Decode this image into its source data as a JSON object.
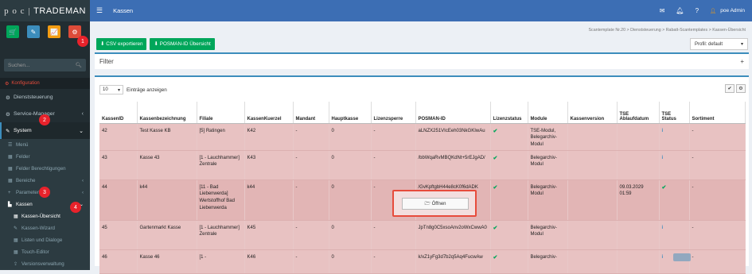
{
  "app": {
    "logo_left": "p o c",
    "logo_right": "TRADEMAN",
    "page_title": "Kassen"
  },
  "topbar": {
    "user": "poe Admin"
  },
  "colors": {
    "quick": [
      "#00a65a",
      "#3c8dbc",
      "#f39c12",
      "#dd4b39"
    ]
  },
  "quick_icons": [
    "cart-icon",
    "pencil-icon",
    "chart-icon",
    "gears-icon"
  ],
  "sidebar": {
    "search_placeholder": "Suchen...",
    "section": "Konfiguration",
    "items": [
      {
        "label": "Dienststeuerung",
        "icon": "⚙"
      },
      {
        "label": "Service-Manager",
        "icon": "⚙",
        "caret": "‹"
      },
      {
        "label": "System",
        "icon": "✎",
        "caret": "⌄"
      }
    ],
    "system_sub": [
      {
        "label": "Menü",
        "icon": "☰"
      },
      {
        "label": "Felder",
        "icon": "▦"
      },
      {
        "label": "Felder Berechtigungen",
        "icon": "▦"
      },
      {
        "label": "Bereiche",
        "icon": "▦",
        "caret": "‹"
      },
      {
        "label": "Parameter",
        "icon": "+",
        "caret": "‹"
      },
      {
        "label": "Kassen",
        "icon": "▙",
        "caret": "⌄"
      }
    ],
    "kassen_sub": [
      {
        "label": "Kassen-Übersicht",
        "icon": "▦"
      },
      {
        "label": "Kassen-Wizard",
        "icon": "✎"
      },
      {
        "label": "Listen und Dialoge",
        "icon": "▦"
      },
      {
        "label": "Touch-Editor",
        "icon": "▦"
      },
      {
        "label": "Versionsverwaltung",
        "icon": "⇪"
      }
    ]
  },
  "breadcrumb": [
    "Scantemplate Nr.20",
    "Dienststeuerung",
    "Rabatt-Scantemplates",
    "Kassen-Übersicht"
  ],
  "buttons": {
    "csv": "CSV exportieren",
    "posman": "POSMAN-ID Übersicht"
  },
  "profil": "Profil: default",
  "filter": {
    "title": "Filter",
    "plus": "+"
  },
  "table": {
    "length_value": "10",
    "length_label": "Einträge anzeigen",
    "headers": [
      "KassenID",
      "Kassenbezeichnung",
      "Filiale",
      "KassenKuerzel",
      "Mandant",
      "Hauptkasse",
      "Lizenzsperre",
      "POSMAN-ID",
      "Lizenzstatus",
      "Module",
      "Kassenversion",
      "TSE Ablaufdatum",
      "TSE Status",
      "Sortiment"
    ],
    "rows": [
      {
        "id": "42",
        "name": "Test Kasse KB",
        "filiale": "[5] Ratingen",
        "kuerzel": "K42",
        "mandant": "-",
        "haupt": "0",
        "sperre": "-",
        "posman": "aLNZX251VIcEeh03NkGKIwAu",
        "module": "TSE-Modul, Belegarchiv-Modul",
        "version": "",
        "tse_date": "",
        "tse_status": "i",
        "sortiment": "-"
      },
      {
        "id": "43",
        "name": "Kasse 43",
        "filiale": "[1 - Lauchhammer] Zentrale",
        "kuerzel": "K43",
        "mandant": "-",
        "haupt": "0",
        "sperre": "-",
        "posman": "/bbWqaRvMBQKdNt+5rEJgAD/",
        "module": "Belegarchiv-Modul",
        "version": "",
        "tse_date": "",
        "tse_status": "i",
        "sortiment": "-"
      },
      {
        "id": "44",
        "name": "k44",
        "filiale": "[11 - Bad Liebenwerda] Wertstoffhof Bad Liebenwerda",
        "kuerzel": "k44",
        "mandant": "-",
        "haupt": "0",
        "sperre": "-",
        "posman": "/GvKpftgbH44e8cK0f6dADK",
        "module": "Belegarchiv-Modul",
        "version": "",
        "tse_date": "09.03.2029 01:59",
        "tse_status": "✔",
        "sortiment": "-"
      },
      {
        "id": "45",
        "name": "Gartenmarkt Kasse",
        "filiale": "[1 - Lauchhammer] Zentrale",
        "kuerzel": "K45",
        "mandant": "-",
        "haupt": "0",
        "sperre": "-",
        "posman": "JpTn8g0C5xsoAnv2oWxCwwA0",
        "module": "Belegarchiv-Modul",
        "version": "",
        "tse_date": "",
        "tse_status": "i",
        "sortiment": "-"
      },
      {
        "id": "46",
        "name": "Kasse 46",
        "filiale": "[1 -",
        "kuerzel": "K46",
        "mandant": "-",
        "haupt": "0",
        "sperre": "-",
        "posman": "k/xZ1yFg3d7b2q5Aq4FucwAw",
        "module": "Belegarchiv-",
        "version": "",
        "tse_date": "",
        "tse_status": "i",
        "sortiment": "-"
      }
    ]
  },
  "popup": {
    "label": "🗁 Öffnen"
  },
  "badges": [
    "1",
    "2",
    "3",
    "4"
  ]
}
